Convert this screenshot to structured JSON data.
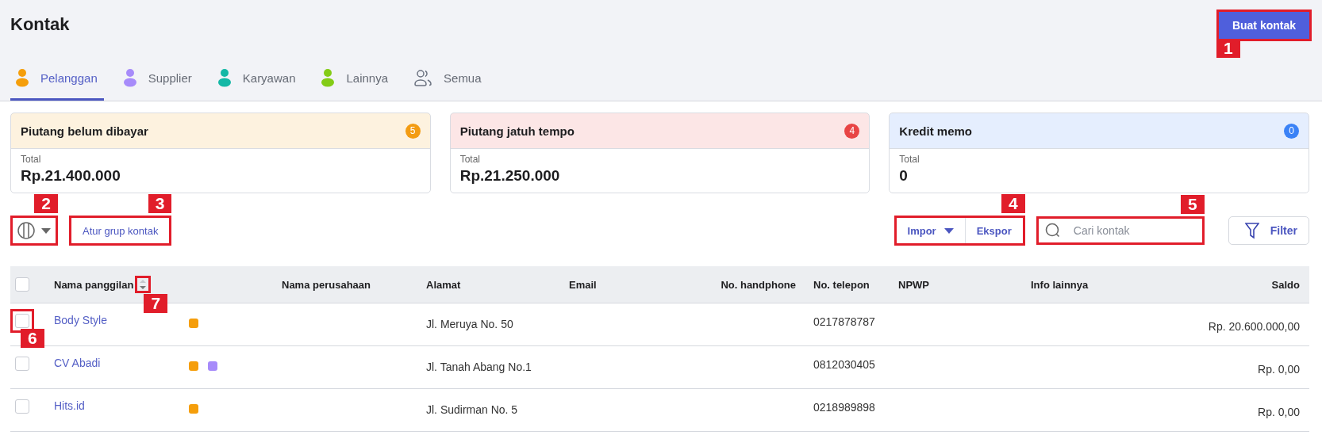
{
  "page": {
    "title": "Kontak",
    "create_button": {
      "label": "Buat kontak",
      "callout": "1"
    }
  },
  "tabs": [
    {
      "label": "Pelanggan",
      "selected": true,
      "kind": "person",
      "color": "#f59e0b"
    },
    {
      "label": "Supplier",
      "selected": false,
      "kind": "person",
      "color": "#a78bfa"
    },
    {
      "label": "Karyawan",
      "selected": false,
      "kind": "person",
      "color": "#14b8a6"
    },
    {
      "label": "Lainnya",
      "selected": false,
      "kind": "person",
      "color": "#84cc16"
    },
    {
      "label": "Semua",
      "selected": false,
      "kind": "group",
      "color": "#6b7280"
    }
  ],
  "summary_cards": [
    {
      "title": "Piutang belum dibayar",
      "count": "5",
      "color": "#f39c12",
      "label": "Total",
      "value": "Rp.21.400.000"
    },
    {
      "title": "Piutang jatuh tempo",
      "count": "4",
      "color": "#e84545",
      "label": "Total",
      "value": "Rp.21.250.000"
    },
    {
      "title": "Kredit memo",
      "count": "0",
      "color": "#3b82f6",
      "label": "Total",
      "value": "0"
    }
  ],
  "toolbar": {
    "columns_callout": "2",
    "group_button": {
      "label": "Atur grup kontak",
      "callout": "3"
    },
    "import_button": "Impor",
    "export_button": "Ekspor",
    "import_export_callout": "4",
    "search": {
      "placeholder": "Cari kontak",
      "callout": "5"
    },
    "filter_button": "Filter"
  },
  "table": {
    "select_all": {
      "checked": false
    },
    "sort_callout": "7",
    "row_checkbox_callout": "6",
    "columns": [
      {
        "label": "Nama panggilan",
        "sortable": true
      },
      {
        "label": "Nama perusahaan",
        "sortable": false
      },
      {
        "label": "Alamat",
        "sortable": false
      },
      {
        "label": "Email",
        "sortable": false
      },
      {
        "label": "No. handphone",
        "sortable": false
      },
      {
        "label": "No. telepon",
        "sortable": false
      },
      {
        "label": "NPWP",
        "sortable": false
      },
      {
        "label": "Info lainnya",
        "sortable": false
      },
      {
        "label": "Saldo",
        "sortable": false
      }
    ],
    "rows": [
      {
        "checked": false,
        "name": "Body Style",
        "tags": [
          {
            "color": "#f59e0b"
          }
        ],
        "address": "Jl. Meruya No. 50",
        "phone": "0217878787",
        "balance": "Rp. 20.600.000,00"
      },
      {
        "checked": false,
        "name": "CV Abadi",
        "tags": [
          {
            "color": "#f59e0b"
          },
          {
            "color": "#a78bfa"
          }
        ],
        "address": "Jl. Tanah Abang No.1",
        "phone": "0812030405",
        "balance": "Rp. 0,00"
      },
      {
        "checked": false,
        "name": "Hits.id",
        "tags": [
          {
            "color": "#f59e0b"
          }
        ],
        "address": "Jl. Sudirman No. 5",
        "phone": "0218989898",
        "balance": "Rp. 0,00"
      }
    ]
  }
}
